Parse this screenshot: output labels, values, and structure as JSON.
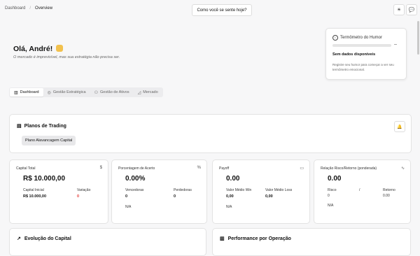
{
  "breadcrumb": {
    "root": "Dashboard",
    "separator": "/",
    "current": "Overview"
  },
  "header": {
    "mood_button": "Como você se sente hoje?",
    "icons": [
      "sun-icon",
      "chat-icon"
    ]
  },
  "greeting": {
    "title": "Olá, André!",
    "subtitle": "O mercado é imprevisível, mas sua estratégia não precisa ser."
  },
  "mood_card": {
    "title": "Termômetro do Humor",
    "value": "--",
    "status": "Sem dados disponíveis",
    "hint": "Registre seu humor para começar a ver seu termômetro emocional."
  },
  "tabs": [
    {
      "label": "Dashboard",
      "icon": "bar-chart-icon",
      "active": true
    },
    {
      "label": "Gestão Estratégica",
      "icon": "target-icon",
      "active": false
    },
    {
      "label": "Gestão de Ativos",
      "icon": "coins-icon",
      "active": false
    },
    {
      "label": "Mercado",
      "icon": "chart-icon",
      "active": false
    }
  ],
  "plans": {
    "title": "Planos de Trading",
    "items": [
      "Plano Alavancagem Capital"
    ]
  },
  "metrics": {
    "capital": {
      "label": "Capital Total",
      "icon": "$",
      "value": "R$ 10.000,00",
      "initial_label": "Capital Inicial",
      "initial_value": "R$ 10.000,00",
      "variation_label": "Variação",
      "variation_value": "0",
      "variation_color": "#e53935"
    },
    "accuracy": {
      "label": "Porcentagem de Acerto",
      "icon": "%",
      "value": "0.00%",
      "wins_label": "Vencedoras",
      "wins_value": "0",
      "losses_label": "Perdedoras",
      "losses_value": "0",
      "note": "N/A"
    },
    "payoff": {
      "label": "Payoff",
      "value": "0.00",
      "avg_win_label": "Valor Médio Win",
      "avg_win_value": "0,00",
      "avg_loss_label": "Valor Médio Loss",
      "avg_loss_value": "0,00",
      "note": "N/A"
    },
    "risk": {
      "label": "Relação Risco/Retorno (ponderada)",
      "value": "0.00",
      "risk_label": "Risco",
      "risk_value": "0",
      "slash": "/",
      "return_label": "Retorno",
      "return_value": "0.00",
      "note": "N/A"
    }
  },
  "sections": {
    "capital_evolution": "Evolução do Capital",
    "performance": "Performance por Operação"
  }
}
